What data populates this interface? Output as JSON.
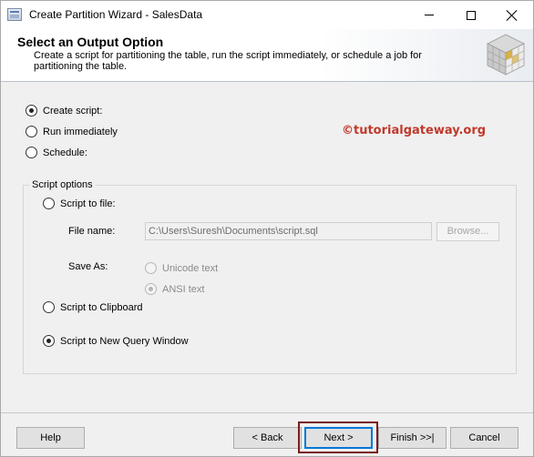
{
  "window": {
    "title": "Create Partition Wizard - SalesData"
  },
  "header": {
    "title": "Select an Output Option",
    "description": "Create a script for partitioning the table, run the script immediately, or schedule a job for partitioning the table."
  },
  "output_options": [
    {
      "label": "Create script:",
      "selected": true
    },
    {
      "label": "Run immediately",
      "selected": false
    },
    {
      "label": "Schedule:",
      "selected": false
    }
  ],
  "watermark": "©tutorialgateway.org",
  "script_options": {
    "legend": "Script options",
    "script_to_file": {
      "label": "Script to file:",
      "selected": false
    },
    "file_name": {
      "label": "File name:",
      "value": "C:\\Users\\Suresh\\Documents\\script.sql",
      "browse_label": "Browse..."
    },
    "save_as": {
      "label": "Save As:",
      "options": [
        {
          "label": "Unicode text",
          "selected": false
        },
        {
          "label": "ANSI text",
          "selected": true
        }
      ]
    },
    "script_to_clipboard": {
      "label": "Script to Clipboard",
      "selected": false
    },
    "script_to_new_query_window": {
      "label": "Script to New Query Window",
      "selected": true
    }
  },
  "footer": {
    "help": "Help",
    "back": "< Back",
    "next": "Next >",
    "finish": "Finish >>|",
    "cancel": "Cancel"
  },
  "colors": {
    "watermark": "#c0392b",
    "highlight_border": "#7a1b1b",
    "dialog_background": "#f0f0f0"
  }
}
